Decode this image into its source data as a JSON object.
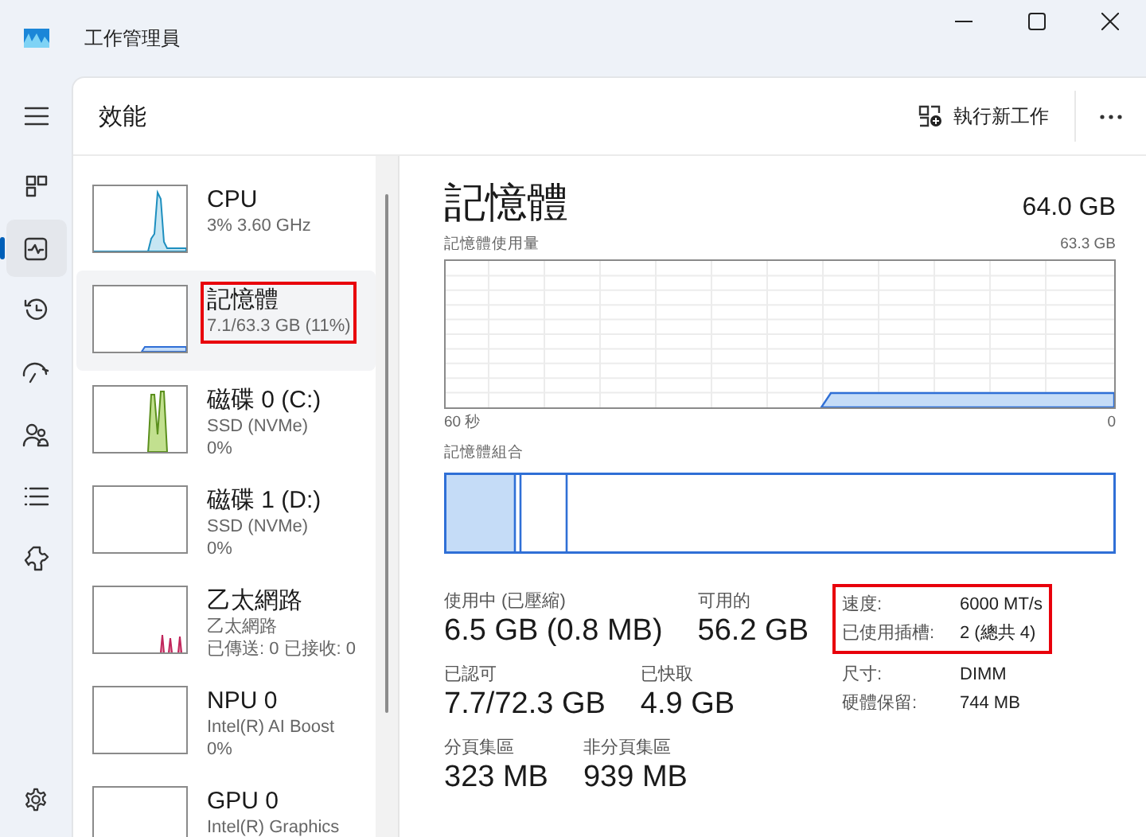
{
  "window": {
    "title": "工作管理員"
  },
  "nav": {
    "items": [
      {
        "kind": "processes",
        "selected": false
      },
      {
        "kind": "performance",
        "selected": true
      },
      {
        "kind": "history",
        "selected": false
      },
      {
        "kind": "startup",
        "selected": false
      },
      {
        "kind": "users",
        "selected": false
      },
      {
        "kind": "details",
        "selected": false
      },
      {
        "kind": "services",
        "selected": false
      }
    ]
  },
  "header": {
    "title": "效能",
    "run_task_button": "執行新工作"
  },
  "devices": [
    {
      "kind": "cpu",
      "name": "CPU",
      "details": [
        "3% 3.60 GHz"
      ],
      "selected": false,
      "highlighted": false
    },
    {
      "kind": "memory",
      "name": "記憶體",
      "details": [
        "7.1/63.3 GB (11%)"
      ],
      "selected": true,
      "highlighted": true
    },
    {
      "kind": "disk",
      "name": "磁碟 0 (C:)",
      "details": [
        "SSD (NVMe)",
        "0%"
      ],
      "selected": false,
      "highlighted": false
    },
    {
      "kind": "idle",
      "name": "磁碟 1 (D:)",
      "details": [
        "SSD (NVMe)",
        "0%"
      ],
      "selected": false,
      "highlighted": false
    },
    {
      "kind": "ethernet",
      "name": "乙太網路",
      "details": [
        "乙太網路",
        "已傳送: 0 已接收: 0"
      ],
      "selected": false,
      "highlighted": false
    },
    {
      "kind": "idle",
      "name": "NPU 0",
      "details": [
        "Intel(R) AI Boost",
        "0%"
      ],
      "selected": false,
      "highlighted": false
    },
    {
      "kind": "idle",
      "name": "GPU 0",
      "details": [
        "Intel(R) Graphics"
      ],
      "selected": false,
      "highlighted": false
    }
  ],
  "detail": {
    "title": "記憶體",
    "total": "64.0 GB",
    "usage_graph": {
      "label": "記憶體使用量",
      "max": "63.3 GB",
      "start": "60 秒",
      "end": "0"
    },
    "composition": {
      "label": "記憶體組合"
    },
    "stats": [
      [
        {
          "label": "使用中 (已壓縮)",
          "value": "6.5 GB (0.8 MB)"
        },
        {
          "label": "可用的",
          "value": "56.2 GB"
        }
      ],
      [
        {
          "label": "已認可",
          "value": "7.7/72.3 GB"
        },
        {
          "label": "已快取",
          "value": "4.9 GB"
        }
      ],
      [
        {
          "label": "分頁集區",
          "value": "323 MB"
        },
        {
          "label": "非分頁集區",
          "value": "939 MB"
        }
      ]
    ],
    "specs": [
      {
        "label": "速度:",
        "value": "6000 MT/s",
        "highlighted": true
      },
      {
        "label": "已使用插槽:",
        "value": "2 (總共 4)",
        "highlighted": true
      },
      {
        "label": "尺寸:",
        "value": "DIMM",
        "highlighted": false
      },
      {
        "label": "硬體保留:",
        "value": "744 MB",
        "highlighted": false
      }
    ]
  }
}
